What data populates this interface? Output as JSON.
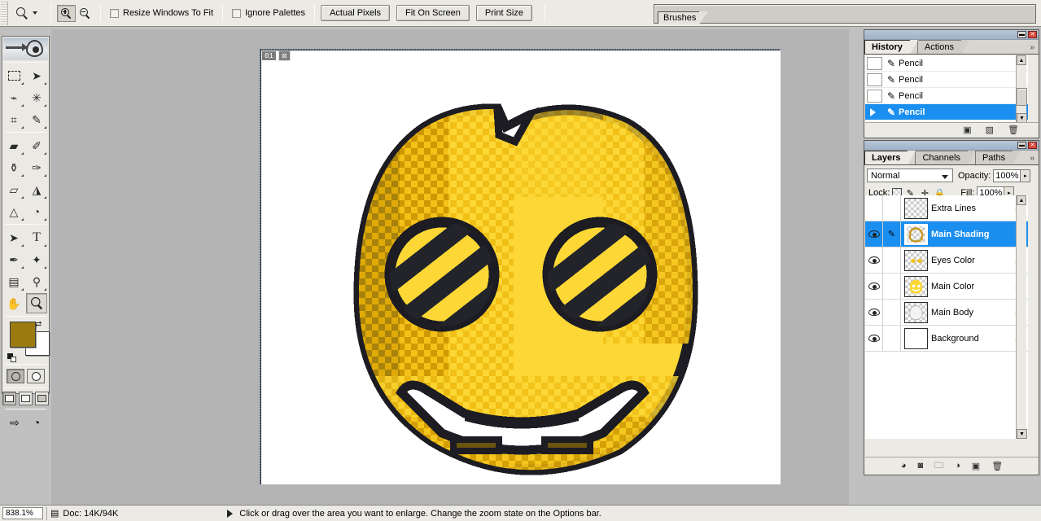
{
  "options_bar": {
    "tool_icon": "magnifier-icon",
    "zoom_in_label": "zoom-in",
    "zoom_out_label": "zoom-out",
    "checkboxes": [
      {
        "label": "Resize Windows To Fit",
        "checked": false
      },
      {
        "label": "Ignore Palettes",
        "checked": false
      }
    ],
    "buttons": [
      "Actual Pixels",
      "Fit On Screen",
      "Print Size"
    ],
    "palette_well_tab": "Brushes"
  },
  "toolbox": {
    "tools": [
      {
        "name": "marquee-tool",
        "glyph": "▭"
      },
      {
        "name": "move-tool",
        "glyph": "➤"
      },
      {
        "name": "lasso-tool",
        "glyph": "✧"
      },
      {
        "name": "magic-wand-tool",
        "glyph": "✳"
      },
      {
        "name": "crop-tool",
        "glyph": "⌗"
      },
      {
        "name": "slice-tool",
        "glyph": "✎"
      },
      {
        "name": "healing-brush-tool",
        "glyph": "✚"
      },
      {
        "name": "brush-tool",
        "glyph": "✐"
      },
      {
        "name": "clone-stamp-tool",
        "glyph": "⚲"
      },
      {
        "name": "history-brush-tool",
        "glyph": "✑"
      },
      {
        "name": "eraser-tool",
        "glyph": "▰"
      },
      {
        "name": "paint-bucket-tool",
        "glyph": "◭"
      },
      {
        "name": "blur-tool",
        "glyph": "△"
      },
      {
        "name": "dodge-tool",
        "glyph": "◓"
      },
      {
        "name": "path-selection-tool",
        "glyph": "➚"
      },
      {
        "name": "type-tool",
        "glyph": "T"
      },
      {
        "name": "pen-tool",
        "glyph": "✒"
      },
      {
        "name": "shape-tool",
        "glyph": "✦"
      },
      {
        "name": "notes-tool",
        "glyph": "▤"
      },
      {
        "name": "eyedropper-tool",
        "glyph": "⚲"
      },
      {
        "name": "hand-tool",
        "glyph": "✋"
      },
      {
        "name": "zoom-tool",
        "glyph": "⚲"
      }
    ],
    "foreground_color": "#9b7a10",
    "background_color": "#ffffff",
    "selected_tool": "zoom-tool"
  },
  "document": {
    "badge_number": "01",
    "badge_icon": "image-icon"
  },
  "history": {
    "tabs": [
      {
        "label": "History",
        "active": true
      },
      {
        "label": "Actions",
        "active": false
      }
    ],
    "items": [
      {
        "label": "Pencil",
        "active": false
      },
      {
        "label": "Pencil",
        "active": false
      },
      {
        "label": "Pencil",
        "active": false
      },
      {
        "label": "Pencil",
        "active": true
      }
    ],
    "footer_icons": [
      "new-document-icon",
      "new-snapshot-icon",
      "delete-icon"
    ]
  },
  "layers": {
    "tabs": [
      {
        "label": "Layers",
        "active": true
      },
      {
        "label": "Channels",
        "active": false
      },
      {
        "label": "Paths",
        "active": false
      }
    ],
    "blend_mode": "Normal",
    "opacity_label": "Opacity:",
    "opacity_value": "100%",
    "lock_label": "Lock:",
    "fill_label": "Fill:",
    "fill_value": "100%",
    "lock_icons": [
      "lock-transparent-icon",
      "lock-image-icon",
      "lock-position-icon",
      "lock-all-icon"
    ],
    "items": [
      {
        "name": "Extra Lines",
        "visible": false,
        "editing": false,
        "locked": true,
        "selected": false,
        "thumb": "lines"
      },
      {
        "name": "Main Shading",
        "visible": true,
        "editing": true,
        "locked": false,
        "selected": true,
        "thumb": "shading"
      },
      {
        "name": "Eyes Color",
        "visible": true,
        "editing": false,
        "locked": true,
        "selected": false,
        "thumb": "eyes"
      },
      {
        "name": "Main Color",
        "visible": true,
        "editing": false,
        "locked": true,
        "selected": false,
        "thumb": "color"
      },
      {
        "name": "Main Body",
        "visible": true,
        "editing": false,
        "locked": true,
        "selected": false,
        "thumb": "body"
      },
      {
        "name": "Background",
        "visible": true,
        "editing": false,
        "locked": true,
        "selected": false,
        "thumb": "white"
      }
    ],
    "footer_icons": [
      "layer-style-icon",
      "layer-mask-icon",
      "layer-group-icon",
      "adjustment-layer-icon",
      "new-layer-icon",
      "delete-layer-icon"
    ]
  },
  "status_bar": {
    "zoom_level": "838.1%",
    "doc_info": "Doc: 14K/94K",
    "hint": "Click or drag over the area you want to enlarge. Change the zoom state on the Options bar."
  },
  "artwork": {
    "description": "pixel-art yellow grinning face with striped eyes",
    "colors": {
      "main_yellow": "#FCD735",
      "mid_yellow": "#F5C41A",
      "dark_yellow": "#D9A200",
      "shade_olive": "#9B7A10",
      "outline": "#1C1C22",
      "white": "#FFFFFF"
    }
  }
}
